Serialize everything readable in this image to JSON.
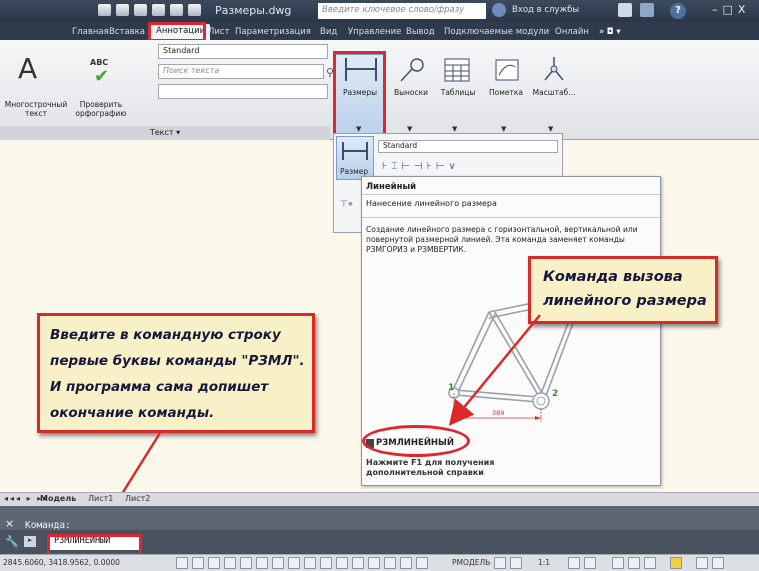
{
  "titlebar": {
    "file_title": "Размеры.dwg",
    "search_placeholder": "Введите ключевое слово/фразу",
    "signin_label": "Вход в службы",
    "help_glyph": "?",
    "window_controls": "–□X"
  },
  "tabs": [
    "Главная",
    "Вставка",
    "Аннотации",
    "Лист",
    "Параметризация",
    "Вид",
    "Управление",
    "Вывод",
    "Подключаемые модули",
    "Онлайн"
  ],
  "active_tab": "Аннотации",
  "ribbon": {
    "multiline_text_label": "Многострочный текст",
    "multiline_text_line1": "Многострочный",
    "multiline_text_line2": "текст",
    "spellcheck_line1": "Проверить",
    "spellcheck_line2": "орфографию",
    "abc_label": "ABC",
    "text_style_value": "Standard",
    "find_text_placeholder": "Поиск текста",
    "text_panel_title": "Текст ▾",
    "buttons": [
      "Размеры",
      "Выноски",
      "Таблицы",
      "Пометка",
      "Масштаб..."
    ]
  },
  "dropdown": {
    "style_value": "Standard",
    "label": "Размер"
  },
  "tooltip": {
    "title": "Линейный",
    "subtitle": "Нанесение линейного размера",
    "description": "Создание линейного размера с горизонтальной, вертикальной или повернутой размерной линией. Эта команда заменяет команды РЗМГОРИЗ и РЗМВЕРТИК.",
    "command_name": "РЗМЛИНЕЙНЫЙ",
    "help_hint": "Нажмите F1 для получения дополнительной справки",
    "diagram_point1": "1",
    "diagram_point2": "2",
    "diagram_dim": "389"
  },
  "callouts": {
    "right_line1": "Команда вызова",
    "right_line2": "линейного размера",
    "left_lines": [
      "Введите в командную строку",
      "первые буквы команды \"РЗМЛ\".",
      "И программа сама допишет",
      "окончание команды."
    ]
  },
  "sheet_tabs": [
    "Модель",
    "Лист1",
    "Лист2"
  ],
  "command": {
    "history_text": "Команда:",
    "input_value": "РЗМЛИНЕЙНЫЙ"
  },
  "status": {
    "coordinates": "2845.6060, 3418.9562, 0.0000",
    "model_label": "РМОДЕЛЬ",
    "scale_label": "1:1"
  },
  "colors": {
    "highlight_red": "#e0262e",
    "callout_bg": "#f8f1c8",
    "drawing_bg": "#fbf7ea"
  }
}
